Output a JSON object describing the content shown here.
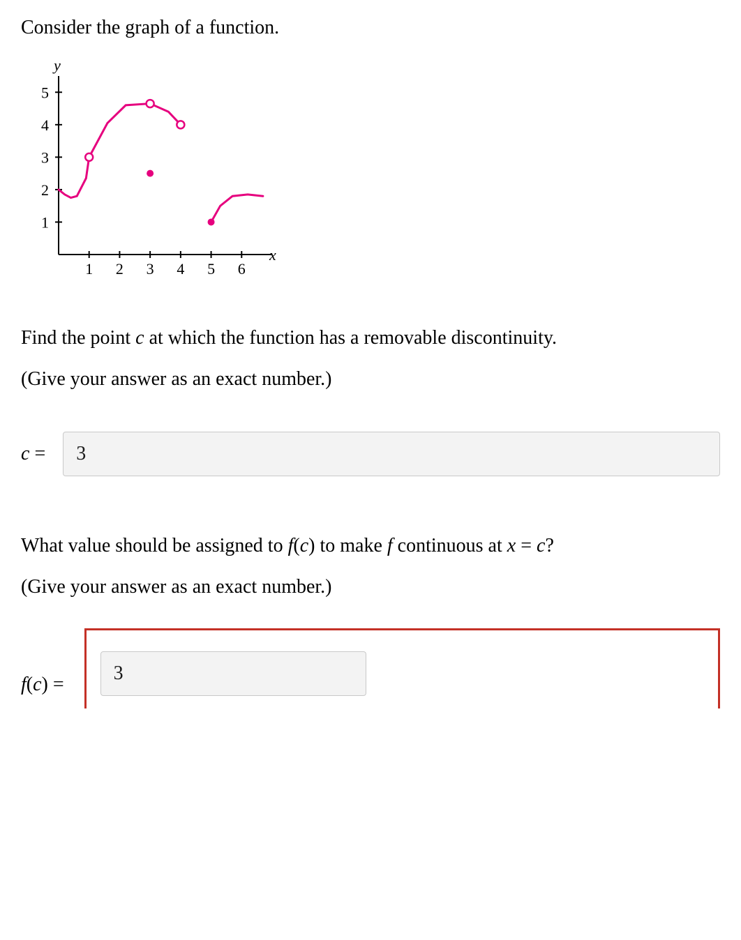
{
  "intro": "Consider the graph of a function.",
  "q1_line1_pre": "Find the point ",
  "q1_var": "c",
  "q1_line1_post": " at which the function has a removable discontinuity.",
  "q1_line2": "(Give your answer as an exact number.)",
  "ans1_label_var": "c",
  "ans1_label_op": " = ",
  "ans1_value": "3",
  "q2_pre": "What value should be assigned to ",
  "q2_fc1": "f",
  "q2_fc1_paren": "(",
  "q2_fc1_var": "c",
  "q2_fc1_close": ")",
  "q2_mid": " to make ",
  "q2_f": "f",
  "q2_mid2": " continuous at ",
  "q2_x": "x",
  "q2_eq": " = ",
  "q2_cvar": "c",
  "q2_qmark": "?",
  "q2_line2": "(Give your answer as an exact number.)",
  "ans2_label_f": "f",
  "ans2_label_paren": "(",
  "ans2_label_var": "c",
  "ans2_label_close": ")",
  "ans2_label_op": " =",
  "ans2_value": "3",
  "chart_data": {
    "type": "line",
    "xlabel": "x",
    "ylabel": "y",
    "x_ticks": [
      1,
      2,
      3,
      4,
      5,
      6
    ],
    "y_ticks": [
      1,
      2,
      3,
      4,
      5
    ],
    "xlim": [
      0,
      7
    ],
    "ylim": [
      0,
      5.5
    ],
    "series": [
      {
        "name": "segment-left",
        "points": [
          [
            0,
            2
          ],
          [
            0.2,
            1.85
          ],
          [
            0.4,
            1.75
          ],
          [
            0.6,
            1.8
          ],
          [
            0.9,
            2.35
          ],
          [
            1.0,
            3.0
          ]
        ],
        "open_end": [
          1.0,
          3.0
        ],
        "open_start": null
      },
      {
        "name": "segment-middle",
        "points": [
          [
            1.0,
            3.0
          ],
          [
            1.6,
            4.05
          ],
          [
            2.2,
            4.6
          ],
          [
            3.0,
            4.65
          ],
          [
            3.6,
            4.4
          ],
          [
            4.0,
            4.0
          ]
        ],
        "open_start": [
          1.0,
          3.0
        ],
        "open_end": [
          4.0,
          4.0
        ],
        "hole_at": [
          3.0,
          4.65
        ]
      },
      {
        "name": "segment-right",
        "points": [
          [
            5.0,
            1.0
          ],
          [
            5.3,
            1.5
          ],
          [
            5.7,
            1.8
          ],
          [
            6.2,
            1.85
          ],
          [
            6.7,
            1.8
          ]
        ],
        "closed_start": [
          5.0,
          1.0
        ]
      }
    ],
    "filled_points": [
      [
        3.0,
        2.5
      ],
      [
        5.0,
        1.0
      ]
    ],
    "open_points": [
      [
        1.0,
        3.0
      ],
      [
        3.0,
        4.65
      ],
      [
        4.0,
        4.0
      ]
    ]
  }
}
